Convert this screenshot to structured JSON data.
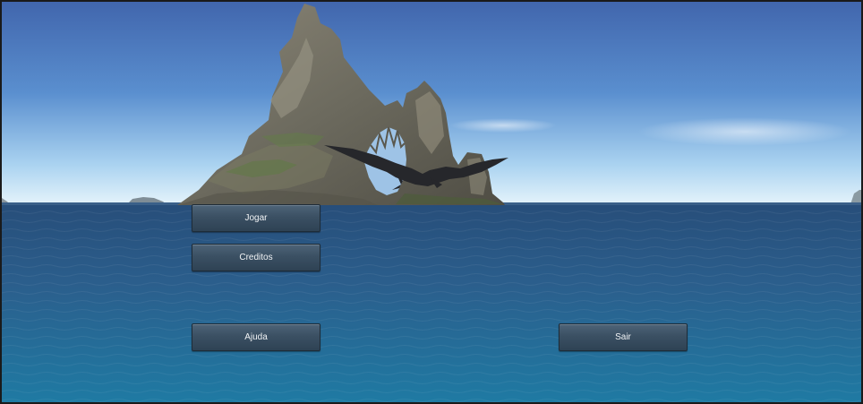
{
  "menu": {
    "play_label": "Jogar",
    "credits_label": "Creditos",
    "help_label": "Ajuda",
    "quit_label": "Sair"
  },
  "colors": {
    "sky_top": "#3f6db3",
    "sky_horizon": "#d8ecf8",
    "sea_top": "#2c5580",
    "sea_bottom": "#1f7aa0",
    "button_face": "#3b5063",
    "button_text": "#f2f4f6"
  }
}
